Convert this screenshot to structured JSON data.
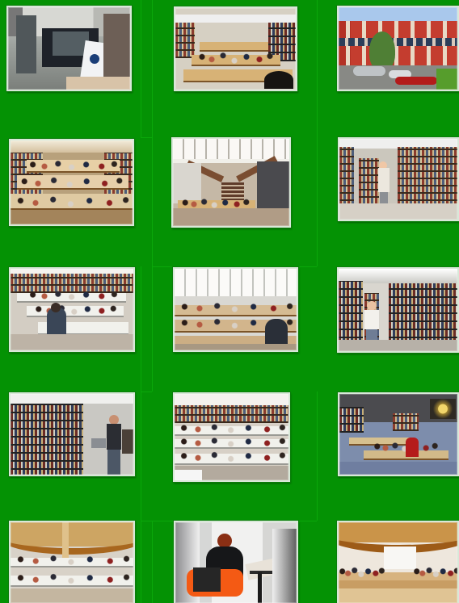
{
  "page": {
    "background_color": "#049204"
  },
  "gallery": {
    "photos": [
      {
        "subject": "library-entrance-desk"
      },
      {
        "subject": "reading-room-with-shelves"
      },
      {
        "subject": "library-building-exterior"
      },
      {
        "subject": "crowded-reading-hall"
      },
      {
        "subject": "atrium-with-staircase"
      },
      {
        "subject": "stacks-reader-browsing"
      },
      {
        "subject": "reading-room-long-tables"
      },
      {
        "subject": "bright-study-hall"
      },
      {
        "subject": "book-stack-aisle"
      },
      {
        "subject": "open-stacks-readers"
      },
      {
        "subject": "large-reading-hall"
      },
      {
        "subject": "blue-floor-study-room"
      },
      {
        "subject": "vaulted-reading-hall"
      },
      {
        "subject": "reader-in-orange-chair"
      },
      {
        "subject": "vaulted-hall-panorama"
      }
    ]
  }
}
